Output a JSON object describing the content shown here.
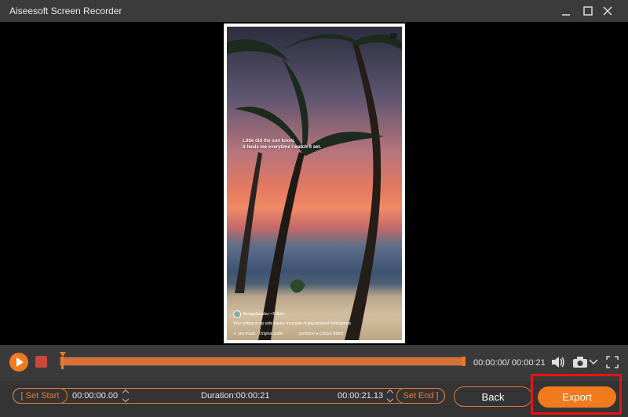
{
  "window": {
    "title": "Aiseesoft Screen Recorder"
  },
  "preview": {
    "caption_line1": "Little did the sun know,",
    "caption_line2": "it heals me everytime i watch it set.",
    "account": "Bonggabawlez • Follow",
    "post_text": "Your setting is my safe haven. #sunsets #calayabisland #philippines",
    "audio": "♬ yes music · Original audio",
    "location": "gordonre   ● Calaya Island"
  },
  "player": {
    "time_display": "00:00:00/ 00:00:21",
    "progress_fraction": 0.0
  },
  "trim": {
    "set_start_label": "[ Set Start",
    "start_time": "00:00:00.00",
    "duration_label": "Duration:00:00:21",
    "end_time": "00:00:21.13",
    "set_end_label": "Set End ]"
  },
  "actions": {
    "back_label": "Back",
    "export_label": "Export"
  },
  "colors": {
    "accent": "#f07a1e",
    "highlight": "#ee1111"
  },
  "icons": [
    "minimize-icon",
    "maximize-icon",
    "close-icon",
    "play-icon",
    "stop-icon",
    "volume-icon",
    "camera-icon",
    "chevron-down-icon",
    "fullscreen-icon"
  ]
}
